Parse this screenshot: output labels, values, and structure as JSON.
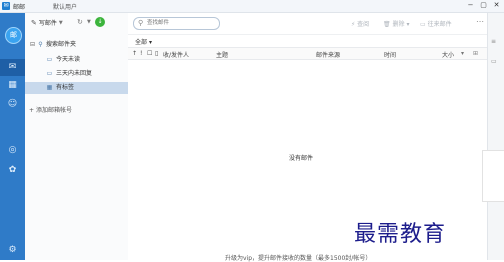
{
  "window": {
    "app_title": "邮邮",
    "user": "默认用户",
    "controls": [
      "−",
      "▢",
      "✕"
    ]
  },
  "sidebar": {
    "avatar_text": "邮"
  },
  "toolbar": {
    "compose_label": "写邮件",
    "search_placeholder": "查找邮件",
    "actions": [
      {
        "label": "查阅"
      },
      {
        "label": "删除"
      },
      {
        "label": "往来邮件"
      }
    ]
  },
  "folders": {
    "account": "搜索邮件夹",
    "items": [
      {
        "label": "今天未读",
        "selected": false
      },
      {
        "label": "三天内未回复",
        "selected": false
      },
      {
        "label": "有标签",
        "selected": true
      }
    ],
    "add_account": "添加邮箱帐号"
  },
  "list": {
    "filter": "全部",
    "columns": [
      "收/发件人",
      "主题",
      "邮件来源",
      "时间",
      "大小"
    ],
    "empty_text": "没有邮件",
    "bottom_tip": "升级为vip，提升邮件接收的数量（最多1500封/帐号）"
  },
  "watermark": "最需教育",
  "colors": {
    "sidebar": "#2f7bc8",
    "selected_folder": "#c8d9ec",
    "status_green": "#3cb43c"
  }
}
